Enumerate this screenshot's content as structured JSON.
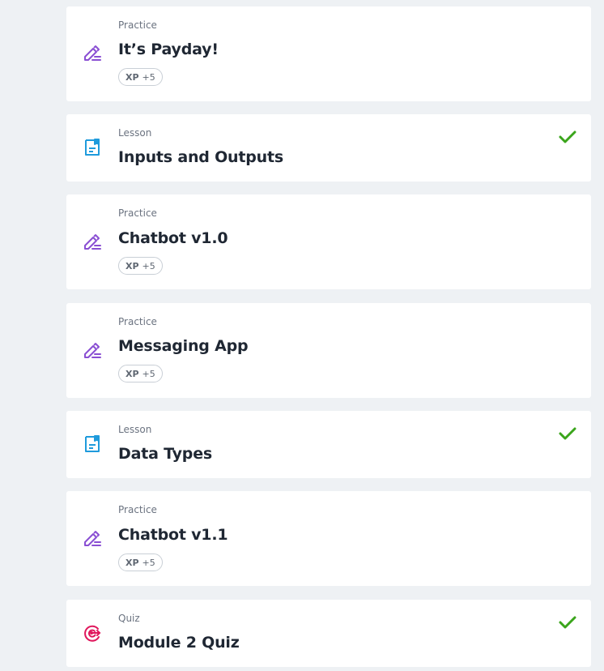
{
  "items": [
    {
      "type": "Practice",
      "title": "It’s Payday!",
      "xp_label": "XP",
      "xp_value": "+5",
      "icon": "pencil-icon",
      "completed": false
    },
    {
      "type": "Lesson",
      "title": "Inputs and Outputs",
      "icon": "lesson-icon",
      "completed": true
    },
    {
      "type": "Practice",
      "title": "Chatbot v1.0",
      "xp_label": "XP",
      "xp_value": "+5",
      "icon": "pencil-icon",
      "completed": false
    },
    {
      "type": "Practice",
      "title": "Messaging App",
      "xp_label": "XP",
      "xp_value": "+5",
      "icon": "pencil-icon",
      "completed": false
    },
    {
      "type": "Lesson",
      "title": "Data Types",
      "icon": "lesson-icon",
      "completed": true
    },
    {
      "type": "Practice",
      "title": "Chatbot v1.1",
      "xp_label": "XP",
      "xp_value": "+5",
      "icon": "pencil-icon",
      "completed": false
    },
    {
      "type": "Quiz",
      "title": "Module 2 Quiz",
      "icon": "target-icon",
      "completed": true
    }
  ],
  "colors": {
    "practice_icon": "#8a4fd3",
    "lesson_icon": "#1f9bdc",
    "quiz_icon": "#e0175c",
    "check": "#3aa51b"
  }
}
